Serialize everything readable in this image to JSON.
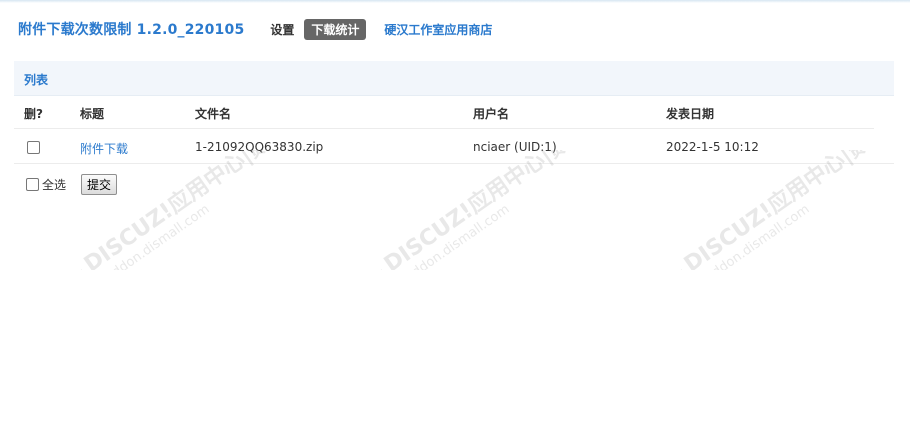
{
  "header": {
    "title": "附件下载次数限制 1.2.0_220105",
    "nav_settings": "设置",
    "nav_active": "下载统计",
    "nav_store": "硬汉工作室应用商店"
  },
  "list_bar": {
    "title": "列表"
  },
  "table": {
    "columns": [
      "删?",
      "标题",
      "文件名",
      "用户名",
      "发表日期"
    ],
    "rows": [
      {
        "title": "附件下载",
        "filename": "1-21092QQ63830.zip",
        "username": "nciaer (UID:1)",
        "date": "2022-1-5 10:12"
      }
    ]
  },
  "footer": {
    "select_all": "全选",
    "submit": "提交"
  },
  "watermark": {
    "text_main": "DISCUZ!应用中心|贰道",
    "text_url": "addon.dismall.com"
  },
  "colors": {
    "accent": "#2b7acd",
    "active_tab_bg": "#666666",
    "list_bar_bg": "#f2f6fb"
  }
}
